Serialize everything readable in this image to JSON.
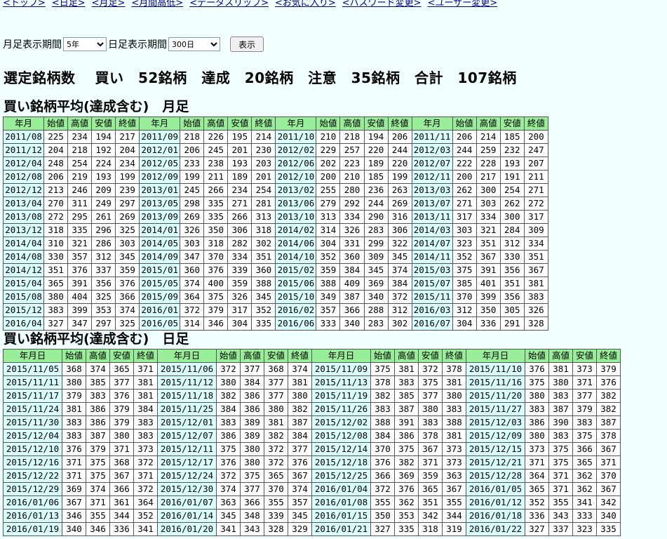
{
  "nav": [
    "<トップ>",
    "<日足>",
    "<月足>",
    "<月間高低>",
    "<データスリップ>",
    "<お気に入り>",
    "<パスワード変更>",
    "<ユーザー変更>"
  ],
  "controls": {
    "month_label": "月足表示期間",
    "month_value": "5年",
    "day_label": "日足表示期間",
    "day_value": "300日",
    "show_button": "表示"
  },
  "summary": "選定銘柄数　 買い　52銘柄　達成　20銘柄　注意　35銘柄　合計　107銘柄",
  "monthly": {
    "title": "買い銘柄平均(達成含む)　月足",
    "headers": [
      "年月",
      "始値",
      "高値",
      "安値",
      "終値"
    ],
    "rows": [
      [
        "2011/08",
        "225",
        "234",
        "194",
        "217",
        "2011/09",
        "218",
        "226",
        "195",
        "214",
        "2011/10",
        "210",
        "218",
        "194",
        "206",
        "2011/11",
        "206",
        "214",
        "185",
        "200"
      ],
      [
        "2011/12",
        "204",
        "218",
        "192",
        "204",
        "2012/01",
        "206",
        "245",
        "201",
        "230",
        "2012/02",
        "229",
        "257",
        "220",
        "244",
        "2012/03",
        "244",
        "259",
        "232",
        "247"
      ],
      [
        "2012/04",
        "248",
        "254",
        "224",
        "234",
        "2012/05",
        "233",
        "238",
        "193",
        "203",
        "2012/06",
        "202",
        "223",
        "189",
        "220",
        "2012/07",
        "222",
        "228",
        "193",
        "207"
      ],
      [
        "2012/08",
        "206",
        "219",
        "193",
        "199",
        "2012/09",
        "199",
        "211",
        "189",
        "201",
        "2012/10",
        "200",
        "210",
        "185",
        "199",
        "2012/11",
        "200",
        "217",
        "191",
        "211"
      ],
      [
        "2012/12",
        "213",
        "246",
        "209",
        "239",
        "2013/01",
        "245",
        "266",
        "234",
        "254",
        "2013/02",
        "255",
        "280",
        "236",
        "263",
        "2013/03",
        "262",
        "300",
        "254",
        "271"
      ],
      [
        "2013/04",
        "270",
        "311",
        "249",
        "297",
        "2013/05",
        "298",
        "335",
        "271",
        "281",
        "2013/06",
        "279",
        "292",
        "244",
        "269",
        "2013/07",
        "271",
        "303",
        "262",
        "272"
      ],
      [
        "2013/08",
        "272",
        "295",
        "261",
        "269",
        "2013/09",
        "269",
        "335",
        "266",
        "313",
        "2013/10",
        "313",
        "334",
        "290",
        "316",
        "2013/11",
        "317",
        "334",
        "300",
        "317"
      ],
      [
        "2013/12",
        "318",
        "335",
        "296",
        "325",
        "2014/01",
        "326",
        "350",
        "306",
        "318",
        "2014/02",
        "314",
        "326",
        "283",
        "306",
        "2014/03",
        "303",
        "321",
        "284",
        "309"
      ],
      [
        "2014/04",
        "310",
        "321",
        "286",
        "303",
        "2014/05",
        "303",
        "318",
        "282",
        "302",
        "2014/06",
        "304",
        "331",
        "299",
        "322",
        "2014/07",
        "323",
        "351",
        "312",
        "334"
      ],
      [
        "2014/08",
        "330",
        "357",
        "312",
        "345",
        "2014/09",
        "347",
        "370",
        "334",
        "351",
        "2014/10",
        "352",
        "360",
        "309",
        "345",
        "2014/11",
        "352",
        "367",
        "330",
        "351"
      ],
      [
        "2014/12",
        "351",
        "376",
        "337",
        "359",
        "2015/01",
        "360",
        "376",
        "339",
        "360",
        "2015/02",
        "359",
        "384",
        "345",
        "374",
        "2015/03",
        "375",
        "391",
        "356",
        "367"
      ],
      [
        "2015/04",
        "365",
        "391",
        "356",
        "376",
        "2015/05",
        "374",
        "400",
        "359",
        "388",
        "2015/06",
        "388",
        "409",
        "369",
        "384",
        "2015/07",
        "385",
        "401",
        "351",
        "381"
      ],
      [
        "2015/08",
        "380",
        "404",
        "325",
        "366",
        "2015/09",
        "364",
        "375",
        "326",
        "345",
        "2015/10",
        "349",
        "387",
        "340",
        "372",
        "2015/11",
        "370",
        "399",
        "356",
        "383"
      ],
      [
        "2015/12",
        "383",
        "399",
        "353",
        "374",
        "2016/01",
        "372",
        "379",
        "317",
        "352",
        "2016/02",
        "357",
        "366",
        "288",
        "312",
        "2016/03",
        "312",
        "350",
        "305",
        "326"
      ],
      [
        "2016/04",
        "327",
        "347",
        "297",
        "325",
        "2016/05",
        "314",
        "346",
        "304",
        "335",
        "2016/06",
        "333",
        "340",
        "283",
        "302",
        "2016/07",
        "304",
        "336",
        "291",
        "328"
      ]
    ]
  },
  "daily": {
    "title": "買い銘柄平均(達成含む)　日足",
    "headers": [
      "年月日",
      "始値",
      "高値",
      "安値",
      "終値"
    ],
    "rows": [
      [
        "2015/11/05",
        "368",
        "374",
        "365",
        "371",
        "2015/11/06",
        "372",
        "377",
        "368",
        "374",
        "2015/11/09",
        "375",
        "381",
        "372",
        "378",
        "2015/11/10",
        "376",
        "381",
        "373",
        "379"
      ],
      [
        "2015/11/11",
        "380",
        "385",
        "377",
        "381",
        "2015/11/12",
        "380",
        "384",
        "377",
        "381",
        "2015/11/13",
        "378",
        "383",
        "375",
        "381",
        "2015/11/16",
        "375",
        "380",
        "371",
        "376"
      ],
      [
        "2015/11/17",
        "379",
        "383",
        "376",
        "381",
        "2015/11/18",
        "382",
        "386",
        "377",
        "380",
        "2015/11/19",
        "382",
        "385",
        "377",
        "380",
        "2015/11/20",
        "380",
        "383",
        "377",
        "382"
      ],
      [
        "2015/11/24",
        "381",
        "386",
        "379",
        "384",
        "2015/11/25",
        "384",
        "386",
        "380",
        "382",
        "2015/11/26",
        "383",
        "387",
        "380",
        "383",
        "2015/11/27",
        "383",
        "387",
        "379",
        "382"
      ],
      [
        "2015/11/30",
        "383",
        "386",
        "379",
        "383",
        "2015/12/01",
        "383",
        "389",
        "381",
        "387",
        "2015/12/02",
        "388",
        "391",
        "383",
        "388",
        "2015/12/03",
        "386",
        "390",
        "383",
        "387"
      ],
      [
        "2015/12/04",
        "383",
        "387",
        "380",
        "383",
        "2015/12/07",
        "386",
        "389",
        "382",
        "384",
        "2015/12/08",
        "384",
        "386",
        "378",
        "381",
        "2015/12/09",
        "380",
        "383",
        "375",
        "378"
      ],
      [
        "2015/12/10",
        "376",
        "379",
        "371",
        "373",
        "2015/12/11",
        "375",
        "380",
        "372",
        "377",
        "2015/12/14",
        "370",
        "375",
        "367",
        "373",
        "2015/12/15",
        "373",
        "375",
        "366",
        "367"
      ],
      [
        "2015/12/16",
        "371",
        "375",
        "368",
        "372",
        "2015/12/17",
        "376",
        "380",
        "372",
        "376",
        "2015/12/18",
        "376",
        "382",
        "371",
        "373",
        "2015/12/21",
        "371",
        "375",
        "365",
        "371"
      ],
      [
        "2015/12/22",
        "371",
        "375",
        "367",
        "371",
        "2015/12/24",
        "372",
        "375",
        "365",
        "367",
        "2015/12/25",
        "366",
        "369",
        "359",
        "363",
        "2015/12/28",
        "364",
        "371",
        "362",
        "370"
      ],
      [
        "2015/12/29",
        "369",
        "374",
        "366",
        "372",
        "2015/12/30",
        "374",
        "377",
        "370",
        "374",
        "2016/01/04",
        "372",
        "376",
        "365",
        "367",
        "2016/01/05",
        "365",
        "371",
        "362",
        "367"
      ],
      [
        "2016/01/06",
        "367",
        "371",
        "361",
        "364",
        "2016/01/07",
        "363",
        "366",
        "355",
        "357",
        "2016/01/08",
        "355",
        "362",
        "351",
        "355",
        "2016/01/12",
        "352",
        "355",
        "341",
        "342"
      ],
      [
        "2016/01/13",
        "346",
        "355",
        "344",
        "352",
        "2016/01/14",
        "345",
        "348",
        "339",
        "345",
        "2016/01/15",
        "350",
        "353",
        "342",
        "344",
        "2016/01/18",
        "336",
        "343",
        "333",
        "340"
      ],
      [
        "2016/01/19",
        "340",
        "346",
        "336",
        "341",
        "2016/01/20",
        "341",
        "343",
        "328",
        "329",
        "2016/01/21",
        "327",
        "335",
        "318",
        "319",
        "2016/01/22",
        "327",
        "337",
        "323",
        "335"
      ]
    ]
  }
}
